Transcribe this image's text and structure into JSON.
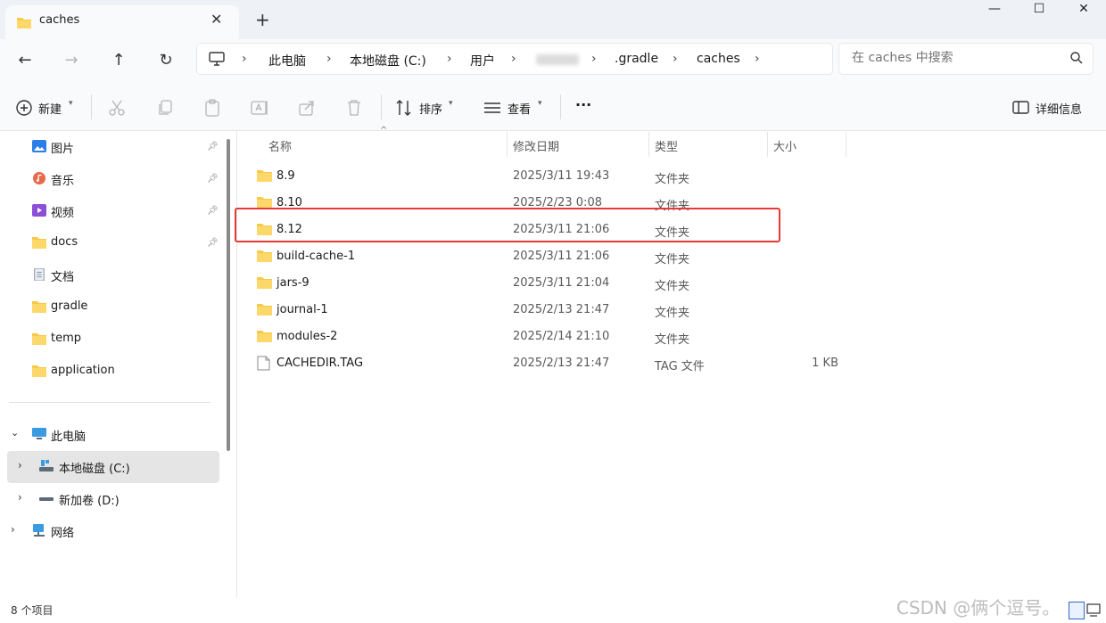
{
  "window": {
    "tab_title": "caches",
    "tab_close": "✕",
    "new_tab": "+",
    "minimize": "—",
    "maximize": "☐",
    "close": "✕"
  },
  "nav": {
    "back": "←",
    "forward": "→",
    "up": "↑",
    "refresh": "↻"
  },
  "breadcrumb": [
    "此电脑",
    "本地磁盘 (C:)",
    "用户",
    ".gradle",
    "caches"
  ],
  "search": {
    "placeholder": "在 caches 中搜索"
  },
  "toolbar": {
    "new_label": "新建",
    "sort_label": "排序",
    "view_label": "查看",
    "more_label": "···",
    "details_label": "详细信息"
  },
  "sidebar": {
    "quick_access": [
      {
        "label": "图片",
        "icon": "pictures-icon",
        "pinned": true
      },
      {
        "label": "音乐",
        "icon": "music-icon",
        "pinned": true
      },
      {
        "label": "视频",
        "icon": "videos-icon",
        "pinned": true
      },
      {
        "label": "docs",
        "icon": "folder-icon",
        "pinned": true
      },
      {
        "label": "文档",
        "icon": "documents-icon",
        "pinned": false
      },
      {
        "label": "gradle",
        "icon": "folder-icon",
        "pinned": false
      },
      {
        "label": "temp",
        "icon": "folder-icon",
        "pinned": false
      },
      {
        "label": "application",
        "icon": "folder-icon",
        "pinned": false
      }
    ],
    "tree": [
      {
        "label": "此电脑",
        "icon": "computer-icon",
        "expanded": true
      },
      {
        "label": "本地磁盘 (C:)",
        "icon": "drive-icon",
        "selected": true
      },
      {
        "label": "新加卷 (D:)",
        "icon": "drive-icon",
        "selected": false
      },
      {
        "label": "网络",
        "icon": "network-icon",
        "expanded": false
      }
    ]
  },
  "columns": {
    "name": "名称",
    "modified": "修改日期",
    "type": "类型",
    "size": "大小"
  },
  "files": [
    {
      "name": "8.9",
      "modified": "2025/3/11 19:43",
      "type": "文件夹",
      "size": "",
      "icon": "folder-icon"
    },
    {
      "name": "8.10",
      "modified": "2025/2/23 0:08",
      "type": "文件夹",
      "size": "",
      "icon": "folder-icon"
    },
    {
      "name": "8.12",
      "modified": "2025/3/11 21:06",
      "type": "文件夹",
      "size": "",
      "icon": "folder-icon",
      "highlighted": true
    },
    {
      "name": "build-cache-1",
      "modified": "2025/3/11 21:06",
      "type": "文件夹",
      "size": "",
      "icon": "folder-icon"
    },
    {
      "name": "jars-9",
      "modified": "2025/3/11 21:04",
      "type": "文件夹",
      "size": "",
      "icon": "folder-icon"
    },
    {
      "name": "journal-1",
      "modified": "2025/2/13 21:47",
      "type": "文件夹",
      "size": "",
      "icon": "folder-icon"
    },
    {
      "name": "modules-2",
      "modified": "2025/2/14 21:10",
      "type": "文件夹",
      "size": "",
      "icon": "folder-icon"
    },
    {
      "name": "CACHEDIR.TAG",
      "modified": "2025/2/13 21:47",
      "type": "TAG 文件",
      "size": "1 KB",
      "icon": "file-icon"
    }
  ],
  "status": {
    "item_count": "8 个项目"
  },
  "watermark": "CSDN @俩个逗号。",
  "colors": {
    "folder": "#f7c948",
    "highlight": "#e53935",
    "selected_bg": "#e5e5e5"
  }
}
